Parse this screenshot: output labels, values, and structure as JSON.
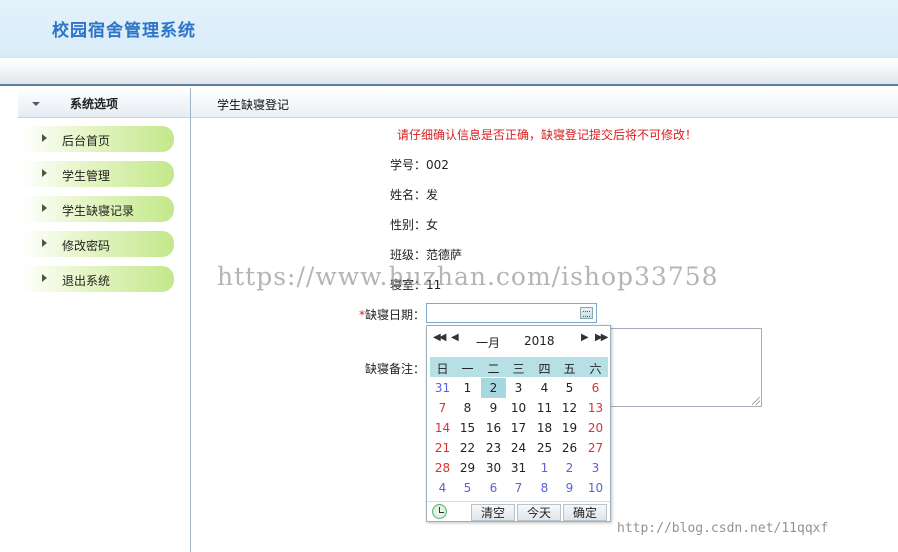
{
  "app": {
    "title": "校园宿舍管理系统"
  },
  "sidebar": {
    "header": "系统选项",
    "items": [
      {
        "label": "后台首页"
      },
      {
        "label": "学生管理"
      },
      {
        "label": "学生缺寝记录"
      },
      {
        "label": "修改密码"
      },
      {
        "label": "退出系统"
      }
    ]
  },
  "main": {
    "title": "学生缺寝登记",
    "notice": "请仔细确认信息是否正确，缺寝登记提交后将不可修改！",
    "fields": {
      "student_id": {
        "label": "学号：",
        "value": "002"
      },
      "name": {
        "label": "姓名：",
        "value": "发"
      },
      "gender": {
        "label": "性别：",
        "value": "女"
      },
      "class": {
        "label": "班级：",
        "value": "范德萨"
      },
      "room": {
        "label": "寝室：",
        "value": "11"
      },
      "absence_date": {
        "required_mark": "*",
        "label": "缺寝日期：",
        "value": ""
      },
      "absence_note": {
        "label": "缺寝备注：",
        "value": ""
      }
    }
  },
  "calendar": {
    "month": "一月",
    "year": "2018",
    "weekdays": [
      "日",
      "一",
      "二",
      "三",
      "四",
      "五",
      "六"
    ],
    "weeks": [
      [
        "31",
        "1",
        "2",
        "3",
        "4",
        "5",
        "6"
      ],
      [
        "7",
        "8",
        "9",
        "10",
        "11",
        "12",
        "13"
      ],
      [
        "14",
        "15",
        "16",
        "17",
        "18",
        "19",
        "20"
      ],
      [
        "21",
        "22",
        "23",
        "24",
        "25",
        "26",
        "27"
      ],
      [
        "28",
        "29",
        "30",
        "31",
        "1",
        "2",
        "3"
      ],
      [
        "4",
        "5",
        "6",
        "7",
        "8",
        "9",
        "10"
      ]
    ],
    "selected": "2",
    "buttons": {
      "clear": "清空",
      "today": "今天",
      "ok": "确定"
    },
    "nav": {
      "prev_year": "◀◀",
      "prev_month": "◀",
      "next_month": "▶",
      "next_year": "▶▶"
    }
  },
  "watermarks": {
    "main": "https://www.huzhan.com/ishop33758",
    "corner": "http://blog.csdn.net/11qqxf"
  },
  "colors": {
    "accent": "#2e74c8",
    "warning": "#d81e1e",
    "weekend": "#d93232",
    "other_month": "#5962d6",
    "calendar_header": "#b6e0e6"
  }
}
